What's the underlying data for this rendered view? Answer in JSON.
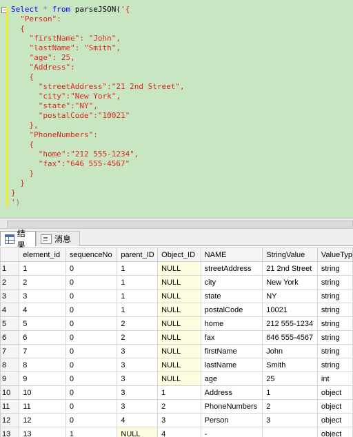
{
  "editor": {
    "lines": [
      [
        {
          "c": "kw",
          "t": "Select"
        },
        {
          "c": "fn",
          "t": " "
        },
        {
          "c": "gr",
          "t": "*"
        },
        {
          "c": "fn",
          "t": " "
        },
        {
          "c": "kw",
          "t": "from"
        },
        {
          "c": "fn",
          "t": " parseJSON("
        },
        {
          "c": "str",
          "t": "'{"
        }
      ],
      [
        {
          "c": "str",
          "t": "  \"Person\":"
        }
      ],
      [
        {
          "c": "str",
          "t": "  {"
        }
      ],
      [
        {
          "c": "str",
          "t": "    \"firstName\": \"John\","
        }
      ],
      [
        {
          "c": "str",
          "t": "    \"lastName\": \"Smith\","
        }
      ],
      [
        {
          "c": "str",
          "t": "    \"age\": 25,"
        }
      ],
      [
        {
          "c": "str",
          "t": "    \"Address\":"
        }
      ],
      [
        {
          "c": "str",
          "t": "    {"
        }
      ],
      [
        {
          "c": "str",
          "t": "      \"streetAddress\":\"21 2nd Street\","
        }
      ],
      [
        {
          "c": "str",
          "t": "      \"city\":\"New York\","
        }
      ],
      [
        {
          "c": "str",
          "t": "      \"state\":\"NY\","
        }
      ],
      [
        {
          "c": "str",
          "t": "      \"postalCode\":\"10021\""
        }
      ],
      [
        {
          "c": "str",
          "t": "    },"
        }
      ],
      [
        {
          "c": "str",
          "t": "    \"PhoneNumbers\":"
        }
      ],
      [
        {
          "c": "str",
          "t": "    {"
        }
      ],
      [
        {
          "c": "str",
          "t": "      \"home\":\"212 555-1234\","
        }
      ],
      [
        {
          "c": "str",
          "t": "      \"fax\":\"646 555-4567\""
        }
      ],
      [
        {
          "c": "str",
          "t": "    }"
        }
      ],
      [
        {
          "c": "str",
          "t": "  }"
        }
      ],
      [
        {
          "c": "str",
          "t": "}"
        }
      ],
      [
        {
          "c": "str",
          "t": "'"
        },
        {
          "c": "gr",
          "t": ")"
        }
      ]
    ]
  },
  "tabs": [
    {
      "label": "结果",
      "icon": "results-grid-icon",
      "active": true
    },
    {
      "label": "消息",
      "icon": "messages-icon",
      "active": false
    }
  ],
  "grid": {
    "columns": [
      "element_id",
      "sequenceNo",
      "parent_ID",
      "Object_ID",
      "NAME",
      "StringValue",
      "ValueTyp"
    ],
    "rows": [
      [
        "1",
        "1",
        "0",
        "1",
        "NULL",
        "streetAddress",
        "21 2nd Street",
        "string"
      ],
      [
        "2",
        "2",
        "0",
        "1",
        "NULL",
        "city",
        "New York",
        "string"
      ],
      [
        "3",
        "3",
        "0",
        "1",
        "NULL",
        "state",
        "NY",
        "string"
      ],
      [
        "4",
        "4",
        "0",
        "1",
        "NULL",
        "postalCode",
        "10021",
        "string"
      ],
      [
        "5",
        "5",
        "0",
        "2",
        "NULL",
        "home",
        "212 555-1234",
        "string"
      ],
      [
        "6",
        "6",
        "0",
        "2",
        "NULL",
        "fax",
        "646 555-4567",
        "string"
      ],
      [
        "7",
        "7",
        "0",
        "3",
        "NULL",
        "firstName",
        "John",
        "string"
      ],
      [
        "8",
        "8",
        "0",
        "3",
        "NULL",
        "lastName",
        "Smith",
        "string"
      ],
      [
        "9",
        "9",
        "0",
        "3",
        "NULL",
        "age",
        "25",
        "int"
      ],
      [
        "10",
        "10",
        "0",
        "3",
        "1",
        "Address",
        "1",
        "object"
      ],
      [
        "11",
        "11",
        "0",
        "3",
        "2",
        "PhoneNumbers",
        "2",
        "object"
      ],
      [
        "12",
        "12",
        "0",
        "4",
        "3",
        "Person",
        "3",
        "object"
      ],
      [
        "13",
        "13",
        "1",
        "NULL",
        "4",
        "-",
        "",
        "object"
      ]
    ]
  },
  "colors": {
    "editor_bg": "#c9e6c2",
    "keyword": "#0000ff",
    "string": "#e1251b",
    "null_cell": "#fffde0"
  }
}
